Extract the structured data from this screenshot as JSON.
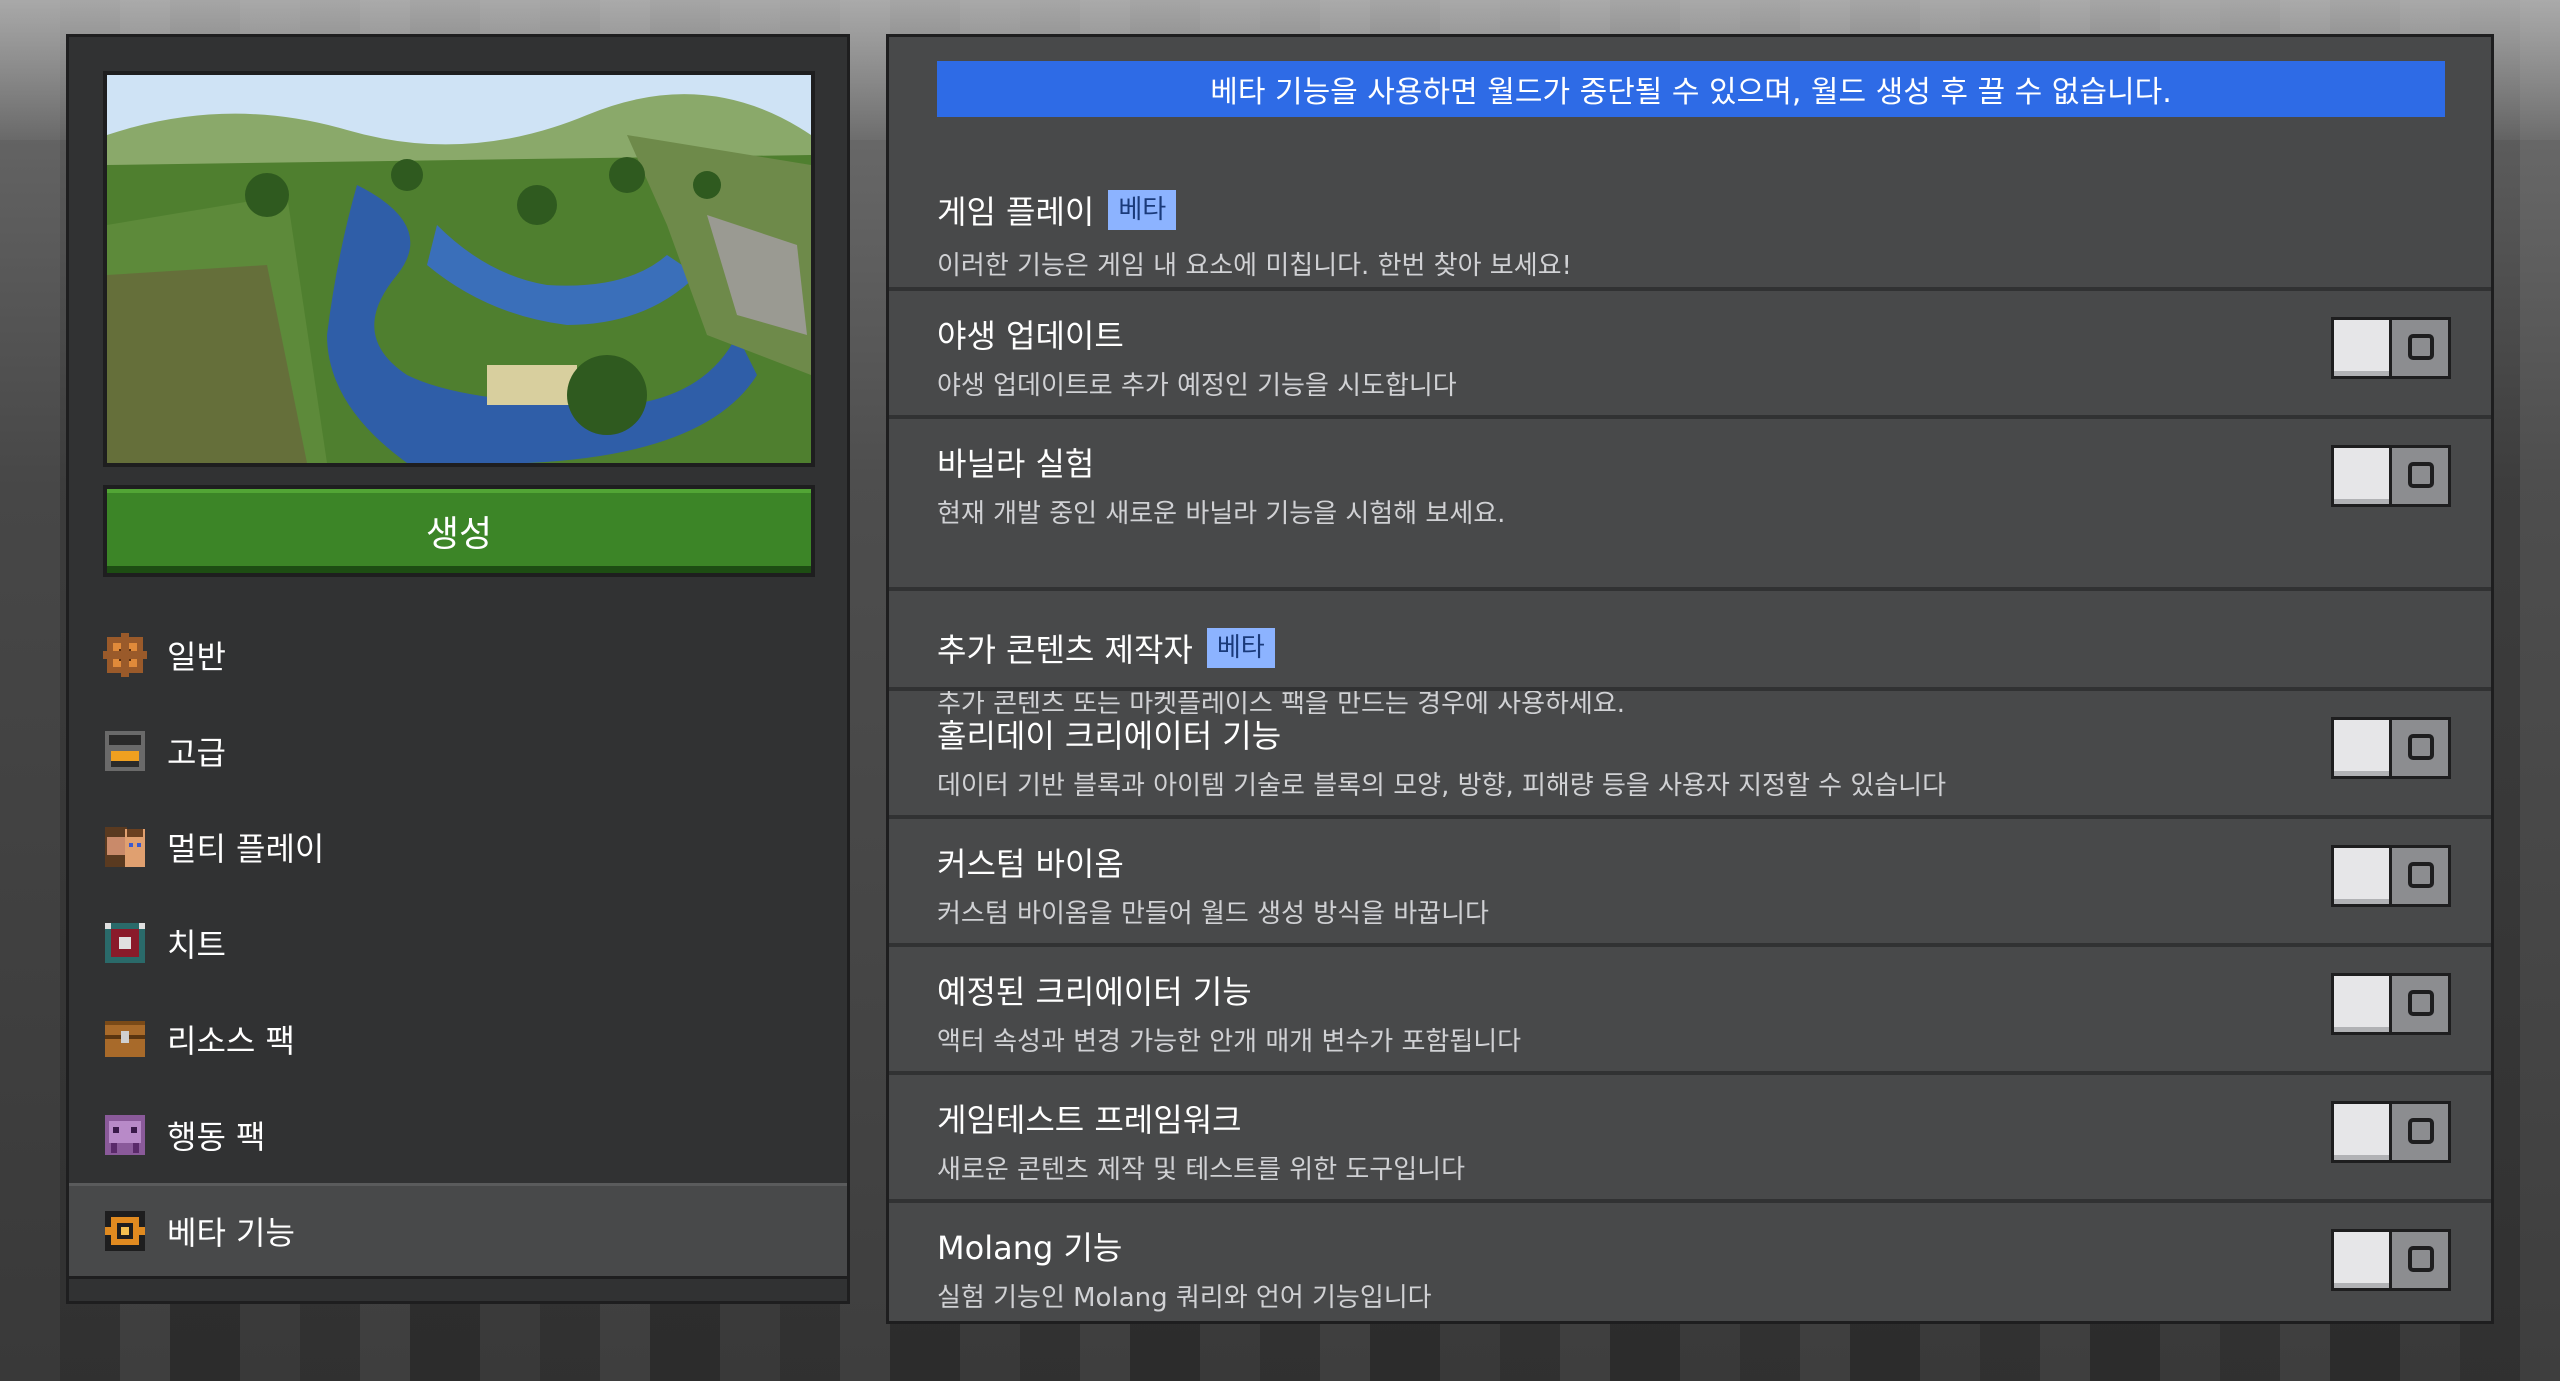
{
  "create_button": "생성",
  "nav": [
    {
      "label": "일반",
      "icon": "gear-icon",
      "active": false
    },
    {
      "label": "고급",
      "icon": "furnace-icon",
      "active": false
    },
    {
      "label": "멀티 플레이",
      "icon": "players-icon",
      "active": false
    },
    {
      "label": "치트",
      "icon": "command-block-icon",
      "active": false
    },
    {
      "label": "리소스 팩",
      "icon": "chest-icon",
      "active": false
    },
    {
      "label": "행동 팩",
      "icon": "behavior-pack-icon",
      "active": false
    },
    {
      "label": "베타 기능",
      "icon": "beta-icon",
      "active": true
    }
  ],
  "banner": "베타 기능을 사용하면 월드가 중단될 수 있으며, 월드 생성 후 끌 수 없습니다.",
  "sections": [
    {
      "title": "게임 플레이",
      "badge": "베타",
      "description": "이러한 기능은 게임 내 요소에 미칩니다. 한번 찾아 보세요!",
      "items": [
        {
          "title": "야생 업데이트",
          "description": "야생 업데이트로 추가 예정인 기능을 시도합니다",
          "enabled": false
        },
        {
          "title": "바닐라 실험",
          "description": "현재 개발 중인 새로운 바닐라 기능을 시험해 보세요.",
          "enabled": false
        }
      ]
    },
    {
      "title": "추가 콘텐츠 제작자",
      "badge": "베타",
      "description": "추가 콘텐츠 또는 마켓플레이스 팩을 만드는 경우에 사용하세요.",
      "items": [
        {
          "title": "홀리데이 크리에이터 기능",
          "description": "데이터 기반 블록과 아이템 기술로 블록의 모양, 방향, 피해량 등을 사용자 지정할 수 있습니다",
          "enabled": false
        },
        {
          "title": "커스텀 바이옴",
          "description": "커스텀 바이옴을 만들어 월드 생성 방식을 바꿉니다",
          "enabled": false
        },
        {
          "title": "예정된 크리에이터 기능",
          "description": "액터 속성과 변경 가능한 안개 매개 변수가 포함됩니다",
          "enabled": false
        },
        {
          "title": "게임테스트 프레임워크",
          "description": "새로운 콘텐츠 제작 및 테스트를 위한 도구입니다",
          "enabled": false
        },
        {
          "title": "Molang 기능",
          "description": "실험 기능인 Molang 쿼리와 언어 기능입니다",
          "enabled": false
        }
      ]
    }
  ],
  "colors": {
    "accent_green": "#3c8527",
    "banner_blue": "#2e6be6",
    "badge_blue": "#8cb3ff"
  }
}
